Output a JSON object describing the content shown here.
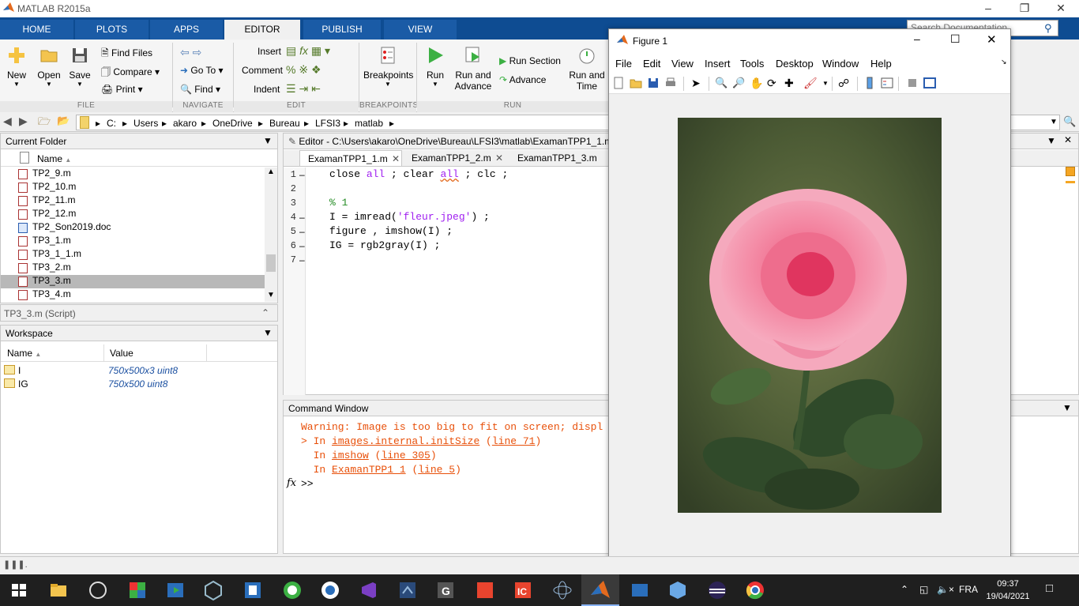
{
  "app": {
    "title": "MATLAB R2015a"
  },
  "tabs": [
    "HOME",
    "PLOTS",
    "APPS",
    "EDITOR",
    "PUBLISH",
    "VIEW"
  ],
  "search_placeholder": "Search Documentation",
  "ribbon": {
    "file": {
      "new": "New",
      "open": "Open",
      "save": "Save",
      "find_files": "Find Files",
      "compare": "Compare",
      "print": "Print",
      "group": "FILE"
    },
    "navigate": {
      "goto": "Go To",
      "find": "Find",
      "group": "NAVIGATE"
    },
    "edit": {
      "insert": "Insert",
      "comment": "Comment",
      "indent": "Indent",
      "group": "EDIT"
    },
    "breakpoints": {
      "label": "Breakpoints",
      "group": "BREAKPOINTS"
    },
    "run": {
      "run": "Run",
      "run_advance_1": "Run and",
      "run_advance_2": "Advance",
      "run_section": "Run Section",
      "advance": "Advance",
      "run_time_1": "Run and",
      "run_time_2": "Time",
      "group": "RUN"
    }
  },
  "path": [
    "C:",
    "Users",
    "akaro",
    "OneDrive",
    "Bureau",
    "LFSI3",
    "matlab"
  ],
  "current_folder": {
    "title": "Current Folder",
    "col_name": "Name",
    "files": [
      "TP2_9.m",
      "TP2_10.m",
      "TP2_11.m",
      "TP2_12.m",
      "TP2_Son2019.doc",
      "TP3_1.m",
      "TP3_1_1.m",
      "TP3_2.m",
      "TP3_3.m",
      "TP3_4.m"
    ],
    "selected": "TP3_3.m",
    "details": "TP3_3.m  (Script)"
  },
  "workspace": {
    "title": "Workspace",
    "col_name": "Name",
    "col_value": "Value",
    "rows": [
      {
        "name": "I",
        "value": "750x500x3 uint8"
      },
      {
        "name": "IG",
        "value": "750x500 uint8"
      }
    ]
  },
  "editor": {
    "title": "Editor - C:\\Users\\akaro\\OneDrive\\Bureau\\LFSI3\\matlab\\ExamanTPP1_1.m",
    "tabs": [
      "ExamanTPP1_1.m",
      "ExamanTPP1_2.m",
      "ExamanTPP1_3.m"
    ],
    "lines": [
      "1",
      "2",
      "3",
      "4",
      "5",
      "6",
      "7"
    ],
    "code": {
      "l1a": "close ",
      "l1b": "all",
      "l1c": " ; clear ",
      "l1d": "all",
      "l1e": " ; clc ;",
      "l3": "% 1",
      "l4a": "I = imread(",
      "l4b": "'fleur.jpeg'",
      "l4c": ") ;",
      "l5": "figure , imshow(I) ;",
      "l6": "IG = rgb2gray(I) ;"
    }
  },
  "command_window": {
    "title": "Command Window",
    "warning": "Warning: Image is too big to fit on screen; displ",
    "l2a": "> In ",
    "l2b": "images.internal.initSize",
    "l2c": " (",
    "l2d": "line 71",
    "l2e": ")",
    "l3a": "  In ",
    "l3b": "imshow",
    "l3c": " (",
    "l3d": "line 305",
    "l3e": ")",
    "l4a": "  In ",
    "l4b": "ExamanTPP1_1",
    "l4c": " (",
    "l4d": "line 5",
    "l4e": ")",
    "prompt": ">>"
  },
  "figure": {
    "title": "Figure 1",
    "menu": [
      "File",
      "Edit",
      "View",
      "Insert",
      "Tools",
      "Desktop",
      "Window",
      "Help"
    ]
  },
  "taskbar": {
    "lang": "FRA",
    "time": "09:37",
    "date": "19/04/2021"
  }
}
